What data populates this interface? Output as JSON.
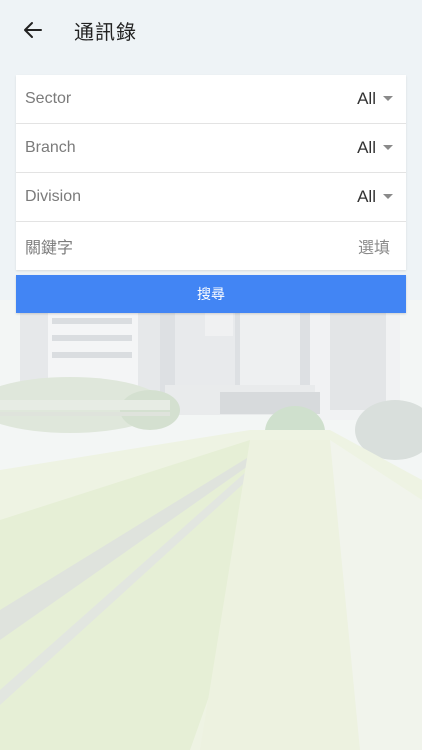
{
  "header": {
    "title": "通訊錄",
    "back_icon": "arrow-left-icon"
  },
  "filters": [
    {
      "label": "Sector",
      "value": "All",
      "icon": "dropdown-caret-icon"
    },
    {
      "label": "Branch",
      "value": "All",
      "icon": "dropdown-caret-icon"
    },
    {
      "label": "Division",
      "value": "All",
      "icon": "dropdown-caret-icon"
    }
  ],
  "keyword": {
    "label": "關鍵字",
    "placeholder": "選填"
  },
  "search_button": {
    "label": "搜尋",
    "color": "#4285f4"
  }
}
